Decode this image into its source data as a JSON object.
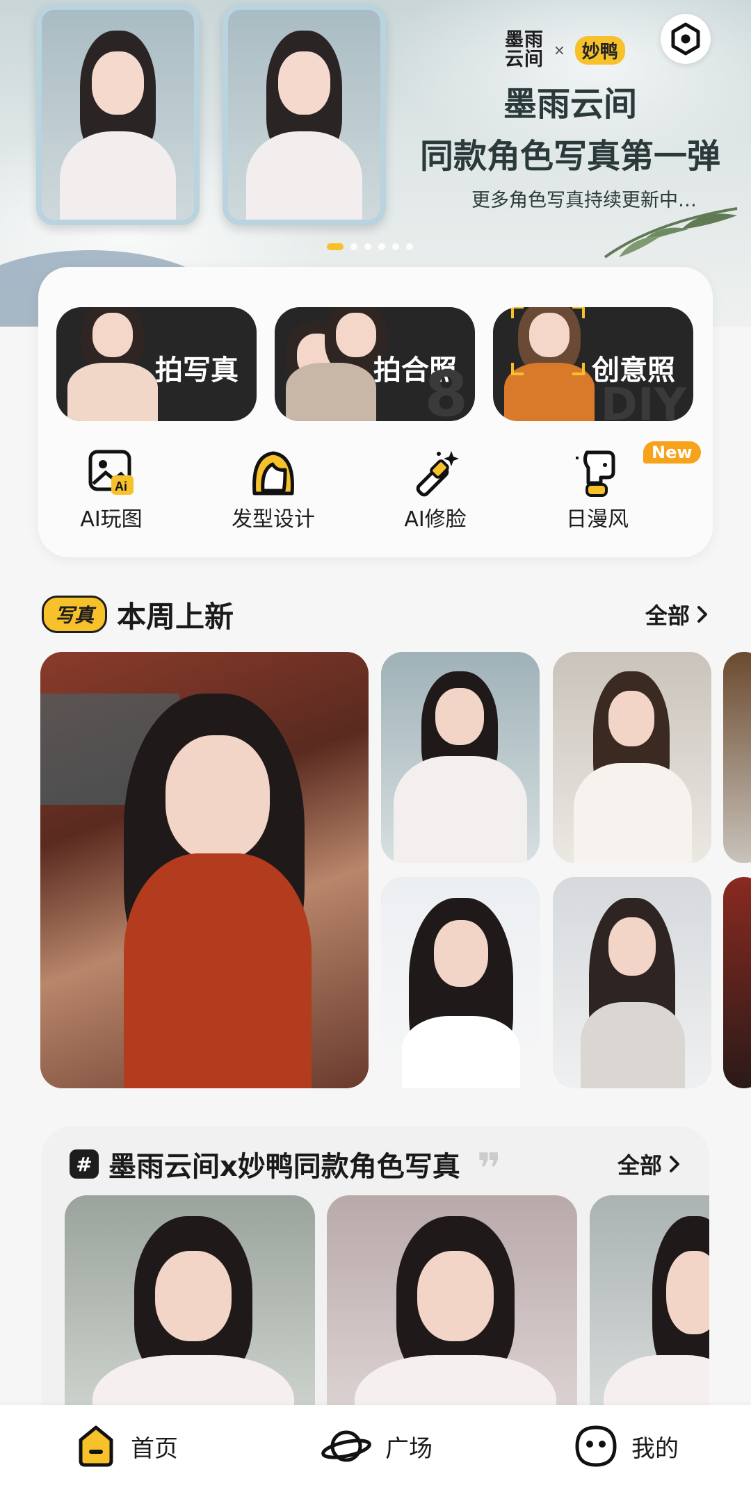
{
  "banner": {
    "logo_left": "墨雨云间",
    "logo_separator": "×",
    "logo_right": "妙鸭",
    "title_line1": "墨雨云间",
    "title_line2": "同款角色写真第一弹",
    "subtitle": "更多角色写真持续更新中…",
    "page_count": 6,
    "active_page": 0
  },
  "features": {
    "primary": [
      {
        "label": "拍写真",
        "icon": "portrait-thumb"
      },
      {
        "label": "拍合照",
        "icon": "duo-portrait-thumb"
      },
      {
        "label": "创意照",
        "icon": "kid-portrait-thumb"
      }
    ],
    "tools": [
      {
        "label": "AI玩图",
        "icon": "ai-image-icon"
      },
      {
        "label": "发型设计",
        "icon": "hair-icon"
      },
      {
        "label": "AI修脸",
        "icon": "magic-wand-icon"
      },
      {
        "label": "日漫风",
        "icon": "anime-face-icon"
      }
    ],
    "new_badge": "New"
  },
  "weekly": {
    "tag": "写真",
    "title": "本周上新",
    "see_all": "全部"
  },
  "collab": {
    "title": "墨雨云间x妙鸭同款角色写真",
    "see_all": "全部"
  },
  "nav": {
    "home": "首页",
    "plaza": "广场",
    "mine": "我的"
  },
  "colors": {
    "accent": "#f6c12b",
    "dark": "#262626",
    "badge": "#f7a21b"
  }
}
